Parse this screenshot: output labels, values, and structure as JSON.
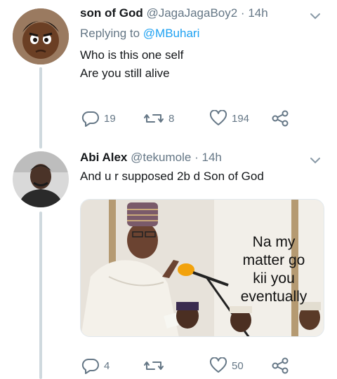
{
  "tweets": [
    {
      "name": "son of God",
      "handle": "@JagaJagaBoy2",
      "dot": "·",
      "time": "14h",
      "replying_prefix": "Replying to",
      "replying_to": "@MBuhari",
      "lines": [
        "Who is this one self",
        "Are you still alive"
      ],
      "replies": "19",
      "retweets": "8",
      "likes": "194"
    },
    {
      "name": "Abi Alex",
      "handle": "@tekumole",
      "dot": "·",
      "time": "14h",
      "lines": [
        "And u r supposed 2b d Son of God"
      ],
      "image_caption": [
        "Na my",
        "matter go",
        "kii you",
        "eventually"
      ],
      "replies": "4",
      "retweets": "",
      "likes": "50"
    }
  ],
  "icons": {
    "reply": "reply-icon",
    "retweet": "retweet-icon",
    "like": "heart-icon",
    "share": "share-icon",
    "more": "chevron-down-icon"
  },
  "colors": {
    "accent": "#1da1f2",
    "muted": "#657786",
    "text": "#14171a",
    "thread_line": "#cfd9de"
  }
}
